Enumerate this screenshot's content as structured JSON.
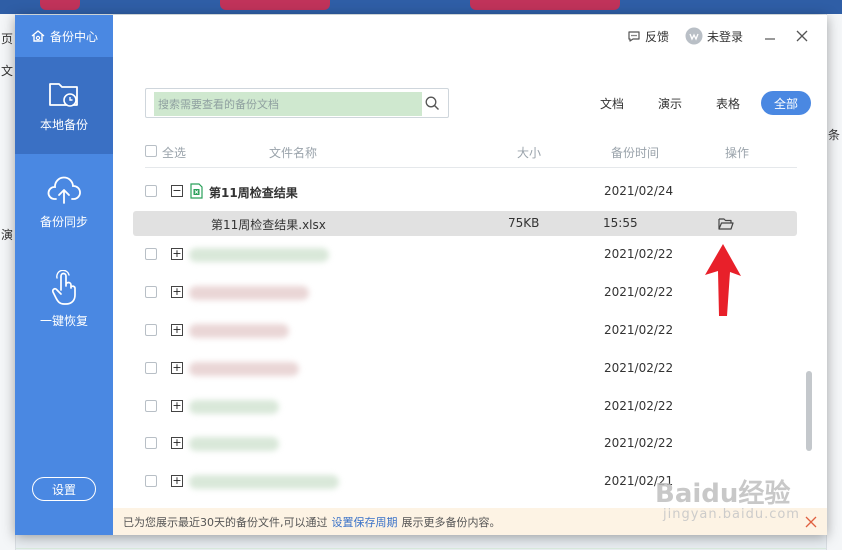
{
  "background": {
    "left_fragments": [
      "页",
      "文",
      "演"
    ],
    "right_fragments": [
      "条"
    ]
  },
  "sidebar": {
    "brand": "备份中心",
    "items": [
      {
        "label": "本地备份",
        "icon": "folder-clock-icon",
        "active": true
      },
      {
        "label": "备份同步",
        "icon": "cloud-upload-icon",
        "active": false
      },
      {
        "label": "一键恢复",
        "icon": "hand-tap-icon",
        "active": false
      }
    ],
    "settings_label": "设置"
  },
  "titlebar": {
    "feedback_label": "反馈",
    "login_label": "未登录"
  },
  "search": {
    "placeholder": "搜索需要查看的备份文档"
  },
  "filters": [
    {
      "label": "文档",
      "active": false
    },
    {
      "label": "演示",
      "active": false
    },
    {
      "label": "表格",
      "active": false
    },
    {
      "label": "全部",
      "active": true
    }
  ],
  "table": {
    "headers": {
      "select_all": "全选",
      "name": "文件名称",
      "size": "大小",
      "time": "备份时间",
      "action": "操作"
    },
    "group": {
      "name": "第11周检查结果",
      "date": "2021/02/24"
    },
    "child": {
      "name": "第11周检查结果.xlsx",
      "size": "75KB",
      "time": "15:55"
    },
    "rows": [
      {
        "date": "2021/02/22"
      },
      {
        "date": "2021/02/22"
      },
      {
        "date": "2021/02/22"
      },
      {
        "date": "2021/02/22"
      },
      {
        "date": "2021/02/22"
      },
      {
        "date": "2021/02/22"
      },
      {
        "date": "2021/02/21"
      }
    ]
  },
  "footer": {
    "text_before": "已为您展示最近30天的备份文件,可以通过",
    "link": "设置保存周期",
    "text_after": "展示更多备份内容。"
  },
  "watermark": {
    "brand": "Baidu经验",
    "url": "jingyan.baidu.com"
  },
  "colors": {
    "sidebar": "#4a88e2",
    "sidebar_active": "#3a70c4",
    "accent": "#4a88e2",
    "arrow": "#e8202a",
    "search_highlight": "#cfe8cf"
  }
}
